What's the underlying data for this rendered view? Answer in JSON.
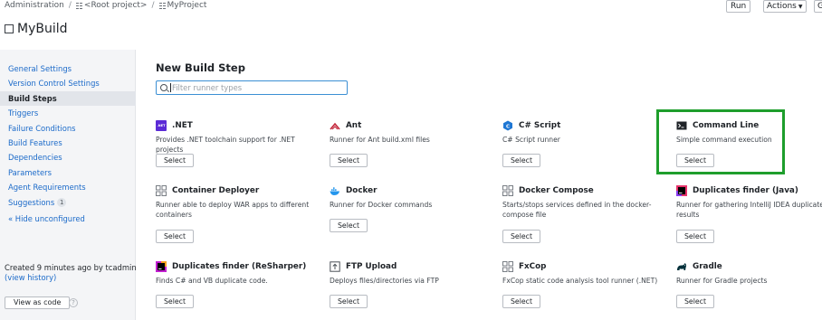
{
  "breadcrumb": {
    "items": [
      "Administration",
      "<Root project>",
      "MyProject"
    ],
    "separator": "/"
  },
  "header": {
    "run_label": "Run",
    "actions_label": "Actions",
    "extra_label": "G"
  },
  "page": {
    "title": "MyBuild"
  },
  "sidebar": {
    "items": [
      {
        "label": "General Settings",
        "active": false
      },
      {
        "label": "Version Control Settings",
        "active": false
      },
      {
        "label": "Build Steps",
        "active": true
      },
      {
        "label": "Triggers",
        "active": false
      },
      {
        "label": "Failure Conditions",
        "active": false
      },
      {
        "label": "Build Features",
        "active": false
      },
      {
        "label": "Dependencies",
        "active": false
      },
      {
        "label": "Parameters",
        "active": false
      },
      {
        "label": "Agent Requirements",
        "active": false
      },
      {
        "label": "Suggestions",
        "active": false,
        "count": "1"
      }
    ],
    "hide_link": "« Hide unconfigured",
    "created_text": "Created 9 minutes ago by tcadmin",
    "view_history": "(view history)",
    "view_as_code": "View as code",
    "help_glyph": "?"
  },
  "main": {
    "title": "New Build Step",
    "filter_placeholder": "Filter runner types",
    "select_label": "Select",
    "runners": [
      {
        "name": ".NET",
        "desc": "Provides .NET toolchain support for .NET projects",
        "icon": "dotnet-icon",
        "icon_text": ".NET"
      },
      {
        "name": "Ant",
        "desc": "Runner for Ant build.xml files",
        "icon": "ant-icon"
      },
      {
        "name": "C# Script",
        "desc": "C# Script runner",
        "icon": "csharp-script-icon"
      },
      {
        "name": "Command Line",
        "desc": "Simple command execution",
        "icon": "command-line-icon"
      },
      {
        "name": "Container Deployer",
        "desc": "Runner able to deploy WAR apps to different containers",
        "icon": "grid-icon"
      },
      {
        "name": "Docker",
        "desc": "Runner for Docker commands",
        "icon": "docker-icon"
      },
      {
        "name": "Docker Compose",
        "desc": "Starts/stops services defined in the docker-compose file",
        "icon": "grid-icon"
      },
      {
        "name": "Duplicates finder (Java)",
        "desc": "Runner for gathering IntelliJ IDEA duplicates results",
        "icon": "intellij-icon"
      },
      {
        "name": "Duplicates finder (ReSharper)",
        "desc": "Finds C# and VB duplicate code.",
        "icon": "resharper-icon"
      },
      {
        "name": "FTP Upload",
        "desc": "Deploys files/directories via FTP",
        "icon": "ftp-icon"
      },
      {
        "name": "FxCop",
        "desc": "FxCop static code analysis tool runner (.NET)",
        "icon": "grid-icon"
      },
      {
        "name": "Gradle",
        "desc": "Runner for Gradle projects",
        "icon": "gradle-icon"
      }
    ],
    "highlight_color": "#1e9e2c",
    "link_color": "#1b6ac9"
  }
}
